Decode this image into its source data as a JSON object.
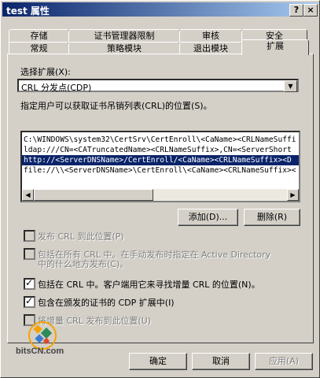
{
  "window": {
    "title": "test 属性",
    "help_label": "?",
    "close_label": "×"
  },
  "tabs": {
    "row1": [
      "存储",
      "证书管理器限制",
      "审核",
      "安全"
    ],
    "row2": [
      "常规",
      "策略模块",
      "退出模块",
      "扩展"
    ]
  },
  "extension": {
    "label": "选择扩展(X):",
    "selected": "CRL 分发点(CDP)"
  },
  "description": "指定用户可以获取证书吊销列表(CRL)的位置(S)。",
  "locations": [
    "C:\\WINDOWS\\system32\\CertSrv\\CertEnroll\\<CaName><CRLNameSuffi",
    "ldap:///CN=<CATruncatedName><CRLNameSuffix>,CN=<ServerShort",
    "http://<ServerDNSName>/CertEnroll/<CaName><CRLNameSuffix><D",
    "file://\\\\<ServerDNSName>\\CertEnroll\\<CaName><CRLNameSuffix><"
  ],
  "buttons": {
    "add": "添加(D)...",
    "remove": "删除(R)",
    "ok": "确定",
    "cancel": "取消",
    "apply": "应用(A)"
  },
  "options": [
    {
      "label": "发布 CRL 到此位置(P)",
      "checked": false,
      "enabled": false
    },
    {
      "label": "包括在所有 CRL 中。在手动发布时指定在 Active Directory",
      "label2": "中的什么地方发布(C)。",
      "checked": false,
      "enabled": false
    },
    {
      "label": "包括在 CRL 中。客户端用它来寻找增量 CRL 的位置(N)。",
      "checked": true,
      "enabled": true
    },
    {
      "label": "包含在颁发的证书的 CDP 扩展中(I)",
      "checked": true,
      "enabled": true
    },
    {
      "label": "将增量 CRL 发布到此位置(U)",
      "checked": false,
      "enabled": false
    }
  ],
  "watermark": "bitsCN.com",
  "colors": {
    "title_bar": "#0a246a",
    "selection": "#0a246a",
    "face": "#d4d0c8"
  }
}
